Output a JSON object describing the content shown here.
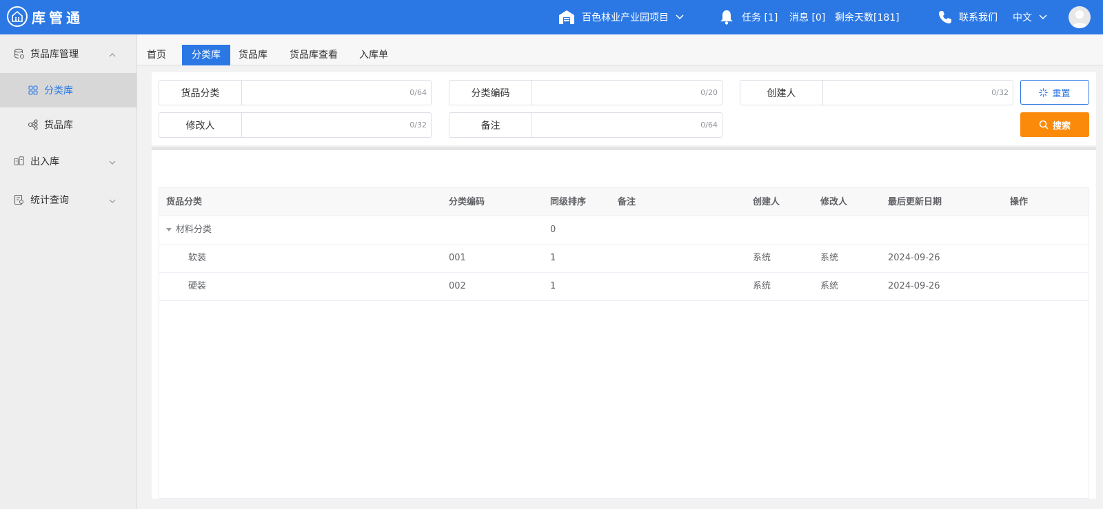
{
  "header": {
    "app_name": "库管通",
    "project": "百色林业产业园项目",
    "tasks": "任务 [1]",
    "messages": "消息 [0]",
    "remaining_days": "剩余天数[181]",
    "contact": "联系我们",
    "language": "中文"
  },
  "sidebar": {
    "groups": [
      {
        "label": "货品库管理",
        "expanded": true,
        "items": [
          {
            "label": "分类库",
            "active": true
          },
          {
            "label": "货品库",
            "active": false
          }
        ]
      },
      {
        "label": "出入库",
        "expanded": false
      },
      {
        "label": "统计查询",
        "expanded": false
      }
    ]
  },
  "tabs": [
    {
      "label": "首页",
      "active": false
    },
    {
      "label": "分类库",
      "active": true
    },
    {
      "label": "货品库",
      "active": false
    },
    {
      "label": "货品库查看",
      "active": false
    },
    {
      "label": "入库单",
      "active": false
    }
  ],
  "filters": [
    {
      "label": "货品分类",
      "count": "0/64"
    },
    {
      "label": "分类编码",
      "count": "0/20"
    },
    {
      "label": "创建人",
      "count": "0/32"
    },
    {
      "label": "修改人",
      "count": "0/32"
    },
    {
      "label": "备注",
      "count": "0/64"
    }
  ],
  "buttons": {
    "reset": "重置",
    "search": "搜索"
  },
  "table": {
    "columns": [
      "货品分类",
      "分类编码",
      "同级排序",
      "备注",
      "创建人",
      "修改人",
      "最后更新日期",
      "操作"
    ],
    "rows": [
      {
        "name": "材料分类",
        "code": "",
        "sort": "0",
        "remark": "",
        "creator": "",
        "modifier": "",
        "updated": "",
        "level": 0,
        "expandable": true
      },
      {
        "name": "软装",
        "code": "001",
        "sort": "1",
        "remark": "",
        "creator": "系统",
        "modifier": "系统",
        "updated": "2024-09-26",
        "level": 1,
        "expandable": false
      },
      {
        "name": "硬装",
        "code": "002",
        "sort": "1",
        "remark": "",
        "creator": "系统",
        "modifier": "系统",
        "updated": "2024-09-26",
        "level": 1,
        "expandable": false
      }
    ]
  },
  "colors": {
    "primary": "#2b78e4",
    "search": "#fb8a0b"
  }
}
